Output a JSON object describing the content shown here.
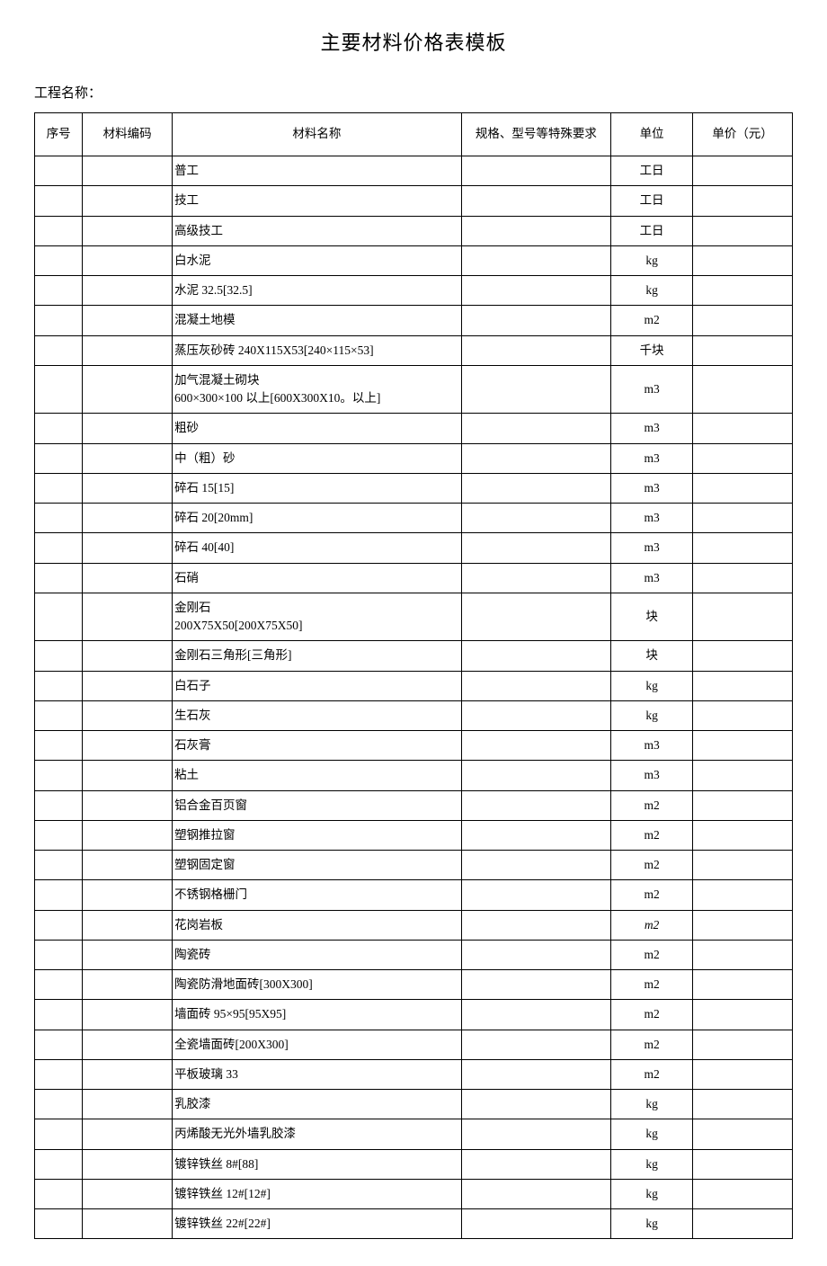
{
  "title": "主要材料价格表模板",
  "project_label": "工程名称：",
  "headers": {
    "seq": "序号",
    "code": "材料编码",
    "name": "材料名称",
    "spec": "规格、型号等特殊要求",
    "unit": "单位",
    "price": "单价（元）"
  },
  "rows": [
    {
      "seq": "",
      "code": "",
      "name": "普工",
      "spec": "",
      "unit": "工日",
      "price": ""
    },
    {
      "seq": "",
      "code": "",
      "name": "技工",
      "spec": "",
      "unit": "工日",
      "price": ""
    },
    {
      "seq": "",
      "code": "",
      "name": "高级技工",
      "spec": "",
      "unit": "工日",
      "price": ""
    },
    {
      "seq": "",
      "code": "",
      "name": "白水泥",
      "spec": "",
      "unit": "kg",
      "price": ""
    },
    {
      "seq": "",
      "code": "",
      "name": "水泥 32.5[32.5]",
      "spec": "",
      "unit": "kg",
      "price": ""
    },
    {
      "seq": "",
      "code": "",
      "name": "混凝土地模",
      "spec": "",
      "unit": "m2",
      "price": ""
    },
    {
      "seq": "",
      "code": "",
      "name": "蒸压灰砂砖 240X115X53[240×115×53]",
      "spec": "",
      "unit": "千块",
      "price": ""
    },
    {
      "seq": "",
      "code": "",
      "name": "加气混凝土砌块\n600×300×100 以上[600X300X10。以上]",
      "spec": "",
      "unit": "m3",
      "price": ""
    },
    {
      "seq": "",
      "code": "",
      "name": "粗砂",
      "spec": "",
      "unit": "m3",
      "price": ""
    },
    {
      "seq": "",
      "code": "",
      "name": "中（粗）砂",
      "spec": "",
      "unit": "m3",
      "price": ""
    },
    {
      "seq": "",
      "code": "",
      "name": "碎石 15[15]",
      "spec": "",
      "unit": "m3",
      "price": ""
    },
    {
      "seq": "",
      "code": "",
      "name": "碎石 20[20mm]",
      "spec": "",
      "unit": "m3",
      "price": ""
    },
    {
      "seq": "",
      "code": "",
      "name": "碎石 40[40]",
      "spec": "",
      "unit": "m3",
      "price": ""
    },
    {
      "seq": "",
      "code": "",
      "name": "石硝",
      "spec": "",
      "unit": "m3",
      "price": ""
    },
    {
      "seq": "",
      "code": "",
      "name": "金刚石\n200X75X50[200X75X50]",
      "spec": "",
      "unit": "块",
      "price": ""
    },
    {
      "seq": "",
      "code": "",
      "name": "金刚石三角形[三角形]",
      "spec": "",
      "unit": "块",
      "price": ""
    },
    {
      "seq": "",
      "code": "",
      "name": "白石子",
      "spec": "",
      "unit": "kg",
      "price": ""
    },
    {
      "seq": "",
      "code": "",
      "name": "生石灰",
      "spec": "",
      "unit": "kg",
      "price": ""
    },
    {
      "seq": "",
      "code": "",
      "name": "石灰膏",
      "spec": "",
      "unit": "m3",
      "price": ""
    },
    {
      "seq": "",
      "code": "",
      "name": "粘土",
      "spec": "",
      "unit": "m3",
      "price": ""
    },
    {
      "seq": "",
      "code": "",
      "name": "铝合金百页窗",
      "spec": "",
      "unit": "m2",
      "price": ""
    },
    {
      "seq": "",
      "code": "",
      "name": "塑钢推拉窗",
      "spec": "",
      "unit": "m2",
      "price": ""
    },
    {
      "seq": "",
      "code": "",
      "name": "塑钢固定窗",
      "spec": "",
      "unit": "m2",
      "price": ""
    },
    {
      "seq": "",
      "code": "",
      "name": "不锈钢格栅门",
      "spec": "",
      "unit": "m2",
      "price": ""
    },
    {
      "seq": "",
      "code": "",
      "name": "花岗岩板",
      "spec": "",
      "unit": "m2",
      "unit_italic": true,
      "price": ""
    },
    {
      "seq": "",
      "code": "",
      "name": "陶瓷砖",
      "spec": "",
      "unit": "m2",
      "price": ""
    },
    {
      "seq": "",
      "code": "",
      "name": "陶瓷防滑地面砖[300X300]",
      "spec": "",
      "unit": "m2",
      "price": ""
    },
    {
      "seq": "",
      "code": "",
      "name": "墙面砖 95×95[95X95]",
      "spec": "",
      "unit": "m2",
      "price": ""
    },
    {
      "seq": "",
      "code": "",
      "name": "全瓷墙面砖[200X300]",
      "spec": "",
      "unit": "m2",
      "price": ""
    },
    {
      "seq": "",
      "code": "",
      "name": "平板玻璃 33",
      "spec": "",
      "unit": "m2",
      "price": ""
    },
    {
      "seq": "",
      "code": "",
      "name": "乳胶漆",
      "spec": "",
      "unit": "kg",
      "price": ""
    },
    {
      "seq": "",
      "code": "",
      "name": "丙烯酸无光外墙乳胶漆",
      "spec": "",
      "unit": "kg",
      "price": ""
    },
    {
      "seq": "",
      "code": "",
      "name": "镀锌铁丝 8#[88]",
      "spec": "",
      "unit": "kg",
      "price": ""
    },
    {
      "seq": "",
      "code": "",
      "name": "镀锌铁丝 12#[12#]",
      "spec": "",
      "unit": "kg",
      "price": ""
    },
    {
      "seq": "",
      "code": "",
      "name": "镀锌铁丝 22#[22#]",
      "spec": "",
      "unit": "kg",
      "price": ""
    }
  ]
}
